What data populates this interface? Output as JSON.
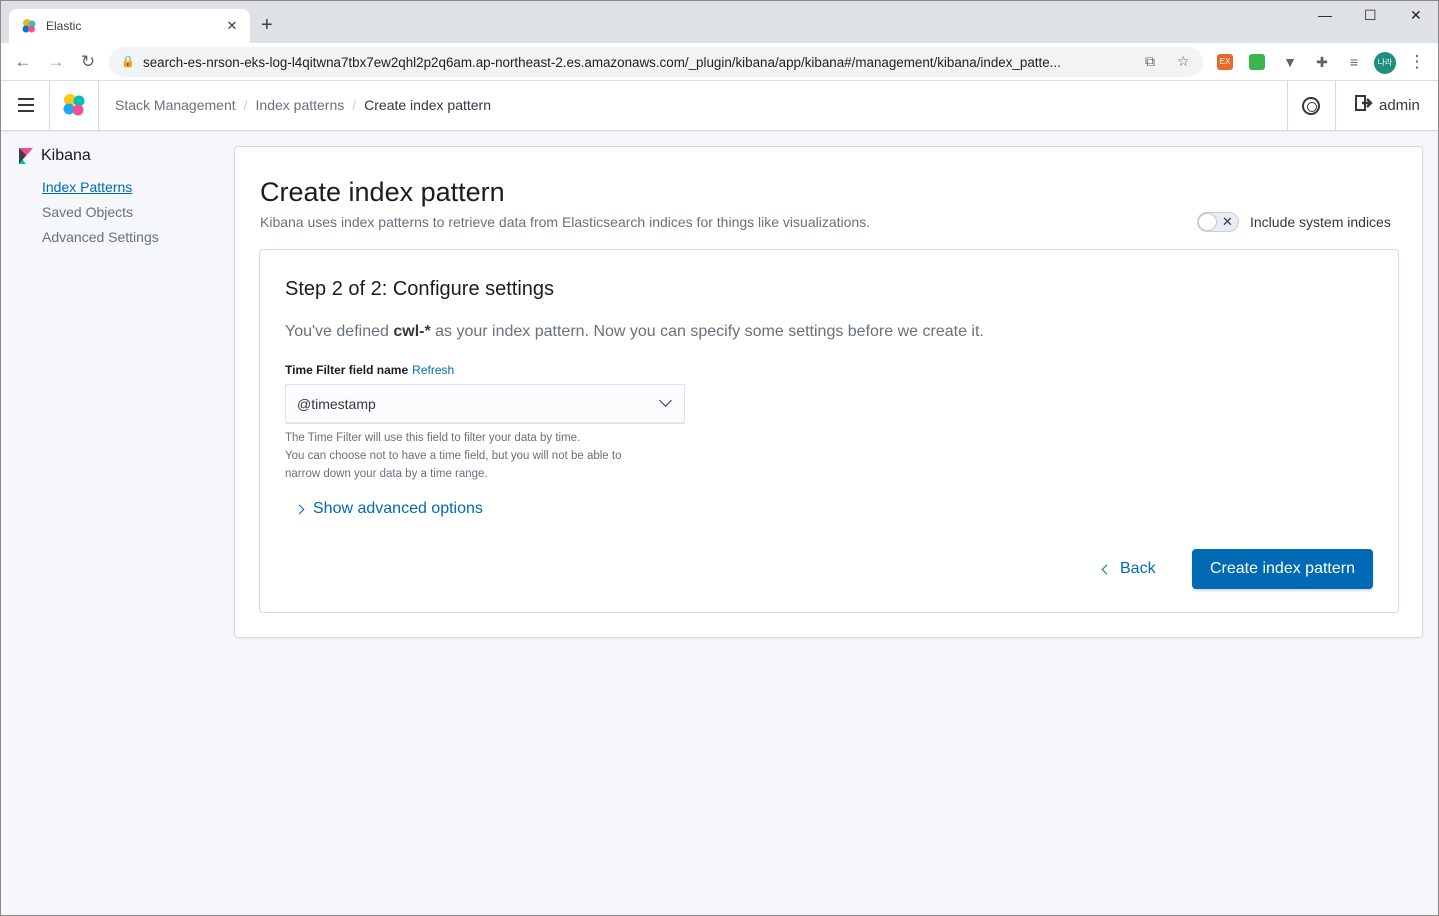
{
  "browser": {
    "tab_title": "Elastic",
    "url": "search-es-nrson-eks-log-l4qitwna7tbx7ew2qhl2p2q6am.ap-northeast-2.es.amazonaws.com/_plugin/kibana/app/kibana#/management/kibana/index_patte...",
    "profile_initials": "나라",
    "extensions": [
      {
        "name": "ex-extension-icon",
        "label": "EX",
        "color": "#e8672b"
      },
      {
        "name": "green-extension-icon",
        "label": "",
        "color": "#3bb54a"
      }
    ]
  },
  "header": {
    "breadcrumbs": [
      "Stack Management",
      "Index patterns",
      "Create index pattern"
    ],
    "user": "admin"
  },
  "sidebar": {
    "title": "Kibana",
    "items": [
      {
        "label": "Index Patterns",
        "active": true
      },
      {
        "label": "Saved Objects",
        "active": false
      },
      {
        "label": "Advanced Settings",
        "active": false
      }
    ]
  },
  "main": {
    "title": "Create index pattern",
    "subtitle": "Kibana uses index patterns to retrieve data from Elasticsearch indices for things like visualizations.",
    "toggle_label": "Include system indices",
    "toggle_on": false,
    "step_title": "Step 2 of 2: Configure settings",
    "defined_prefix": "You've defined ",
    "pattern": "cwl-*",
    "defined_suffix": " as your index pattern. Now you can specify some settings before we create it.",
    "field_label": "Time Filter field name",
    "refresh_label": "Refresh",
    "select_value": "@timestamp",
    "help_lines": [
      "The Time Filter will use this field to filter your data by time.",
      "You can choose not to have a time field, but you will not be able to",
      "narrow down your data by a time range."
    ],
    "advanced_label": "Show advanced options",
    "back_label": "Back",
    "create_label": "Create index pattern"
  }
}
